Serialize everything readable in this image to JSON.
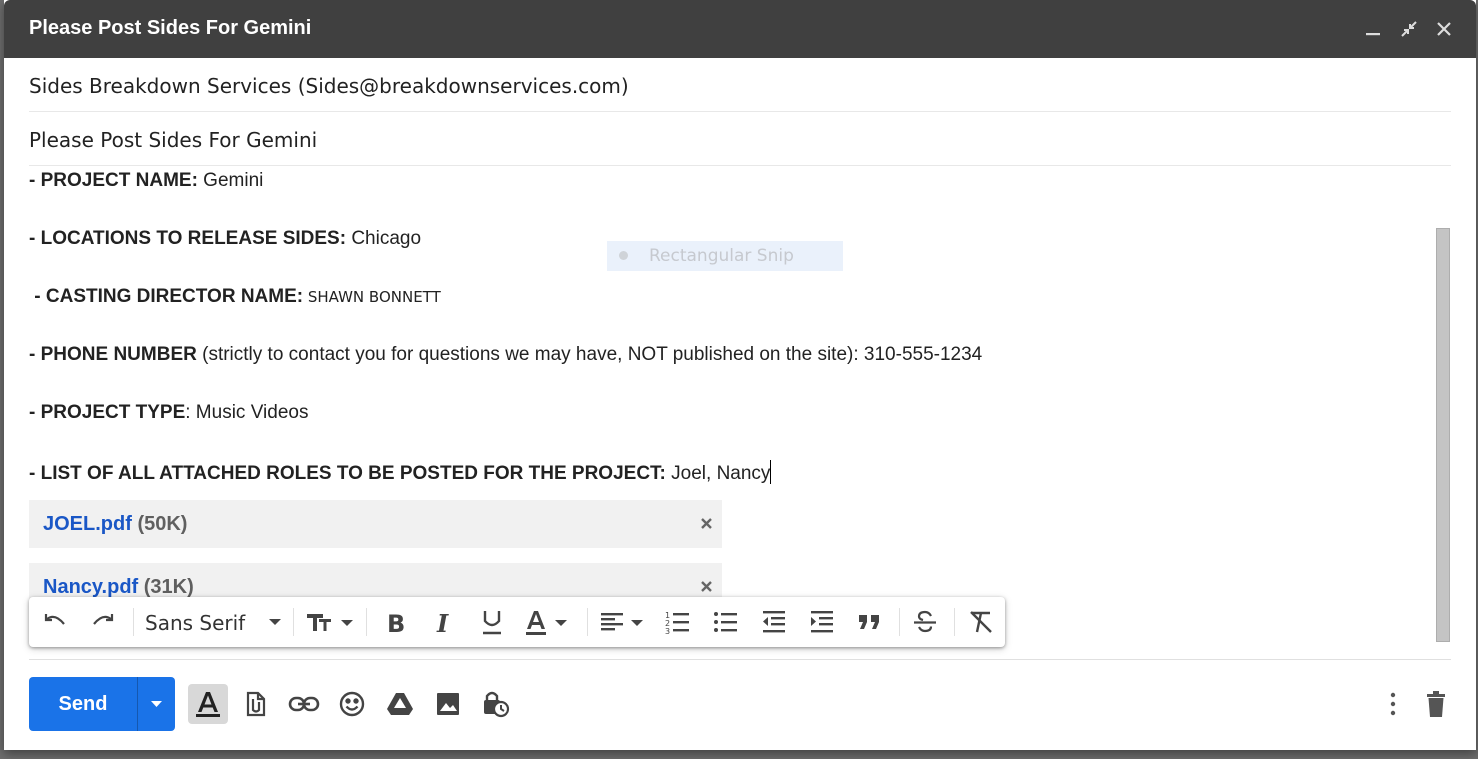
{
  "window": {
    "title": "Please Post Sides For Gemini",
    "controls": [
      "minimize-icon",
      "exit-fullscreen-icon",
      "close-icon"
    ]
  },
  "recipients": "Sides Breakdown Services (Sides@breakdownservices.com)",
  "subject": "Please Post Sides For Gemini",
  "body": {
    "project_name": {
      "label": "- PROJECT NAME:",
      "value": " Gemini"
    },
    "locations": {
      "label": "- LOCATIONS TO RELEASE SIDES:",
      "value": " Chicago"
    },
    "casting_director": {
      "label": " - CASTING DIRECTOR NAME:",
      "value": " SHAWN BONNETT"
    },
    "phone": {
      "label": "- PHONE NUMBER",
      "value": " (strictly to contact you for questions we may have, NOT published on the site): 310-555-1234"
    },
    "project_type": {
      "label": "- PROJECT TYPE",
      "value": ": Music Videos"
    },
    "roles": {
      "label": "- LIST OF ALL ATTACHED ROLES TO BE POSTED FOR THE PROJECT:",
      "value": " Joel, Nancy"
    }
  },
  "attachments": [
    {
      "name": "JOEL.pdf",
      "size": " (50K)"
    },
    {
      "name": "Nancy.pdf",
      "size": " (31K)"
    }
  ],
  "snip_overlay": {
    "label": "Rectangular Snip"
  },
  "format_toolbar": {
    "font": "Sans Serif",
    "buttons": [
      "undo-icon",
      "redo-icon",
      "font-size-icon",
      "bold-icon",
      "italic-icon",
      "underline-icon",
      "text-color-icon",
      "align-icon",
      "numbered-list-icon",
      "bulleted-list-icon",
      "indent-less-icon",
      "indent-more-icon",
      "quote-icon",
      "strikethrough-icon",
      "remove-formatting-icon"
    ]
  },
  "bottom_bar": {
    "send_label": "Send",
    "buttons": [
      "formatting-options-icon",
      "attach-file-icon",
      "insert-link-icon",
      "emoji-icon",
      "drive-icon",
      "insert-photo-icon",
      "confidential-mode-icon",
      "more-options-icon",
      "discard-draft-icon"
    ]
  },
  "colors": {
    "titlebar": "#404040",
    "send": "#1a73e8",
    "attachment_link": "#1a57c6"
  }
}
